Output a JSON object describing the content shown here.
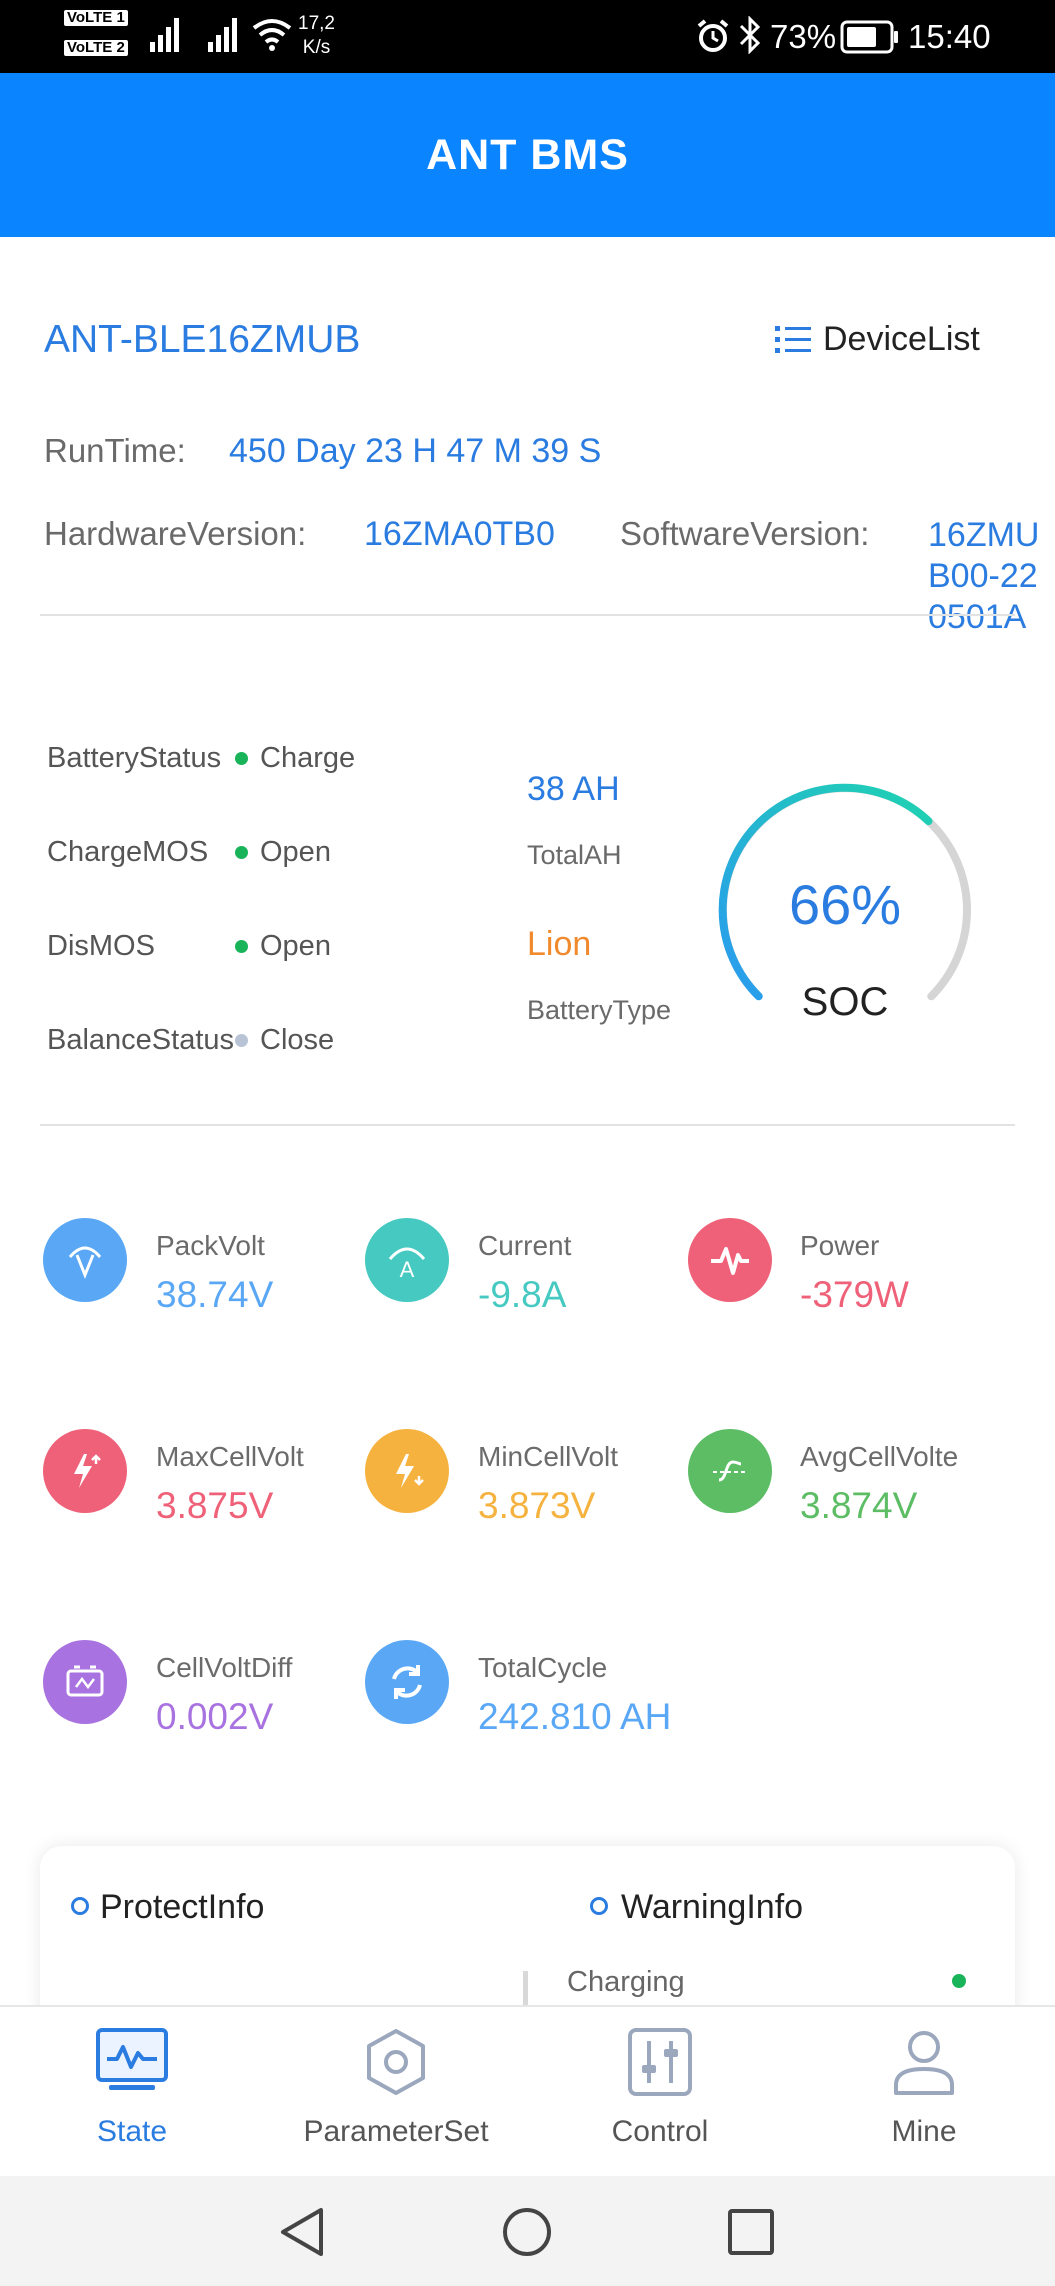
{
  "status_bar": {
    "volte1": "VoLTE 1",
    "volte2": "VoLTE 2",
    "net_speed_value": "17,2",
    "net_speed_unit": "K/s",
    "battery_pct": "73%",
    "time": "15:40"
  },
  "app_bar": {
    "title": "ANT BMS"
  },
  "device": {
    "name": "ANT-BLE16ZMUB",
    "device_list_label": "DeviceList",
    "runtime_label": "RunTime:",
    "runtime_value": "450 Day 23 H 47 M 39 S",
    "hardware_label": "HardwareVersion:",
    "hardware_value": "16ZMA0TB0",
    "software_label": "SoftwareVersion:",
    "software_value_1": "16ZMU",
    "software_value_2": "B00-22",
    "software_value_3": "0501A"
  },
  "status": {
    "battery_status_label": "BatteryStatus",
    "battery_status_value": "Charge",
    "charge_mos_label": "ChargeMOS",
    "charge_mos_value": "Open",
    "dis_mos_label": "DisMOS",
    "dis_mos_value": "Open",
    "balance_label": "BalanceStatus",
    "balance_value": "Close",
    "total_ah_value": "38 AH",
    "total_ah_label": "TotalAH",
    "battery_type_value": "Lion",
    "battery_type_label": "BatteryType",
    "soc_value": "66%",
    "soc_label": "SOC",
    "soc_fraction": 0.66,
    "colors": {
      "on": "#19b35a",
      "off": "#b9c3d6"
    }
  },
  "metrics": [
    {
      "label": "PackVolt",
      "value": "38.74V",
      "color": "#5aa8f5",
      "icon": "pack-volt-icon"
    },
    {
      "label": "Current",
      "value": "-9.8A",
      "color": "#45c9c1",
      "icon": "current-icon"
    },
    {
      "label": "Power",
      "value": "-379W",
      "color": "#ee6178",
      "icon": "power-icon"
    },
    {
      "label": "MaxCellVolt",
      "value": "3.875V",
      "color": "#ee6178",
      "icon": "max-cell-volt-icon"
    },
    {
      "label": "MinCellVolt",
      "value": "3.873V",
      "color": "#f5b23f",
      "icon": "min-cell-volt-icon"
    },
    {
      "label": "AvgCellVolte",
      "value": "3.874V",
      "color": "#5cbd65",
      "icon": "avg-cell-volt-icon"
    },
    {
      "label": "CellVoltDiff",
      "value": "0.002V",
      "color": "#a872e0",
      "icon": "cell-volt-diff-icon"
    },
    {
      "label": "TotalCycle",
      "value": "242.810 AH",
      "color": "#5aa8f5",
      "icon": "total-cycle-icon"
    }
  ],
  "info": {
    "protect_label": "ProtectInfo",
    "warning_label": "WarningInfo",
    "charging_label": "Charging"
  },
  "nav": {
    "items": [
      {
        "label": "State",
        "active": true
      },
      {
        "label": "ParameterSet",
        "active": false
      },
      {
        "label": "Control",
        "active": false
      },
      {
        "label": "Mine",
        "active": false
      }
    ],
    "active_color": "#2a7ce0",
    "inactive_color": "#9aa7bd"
  }
}
